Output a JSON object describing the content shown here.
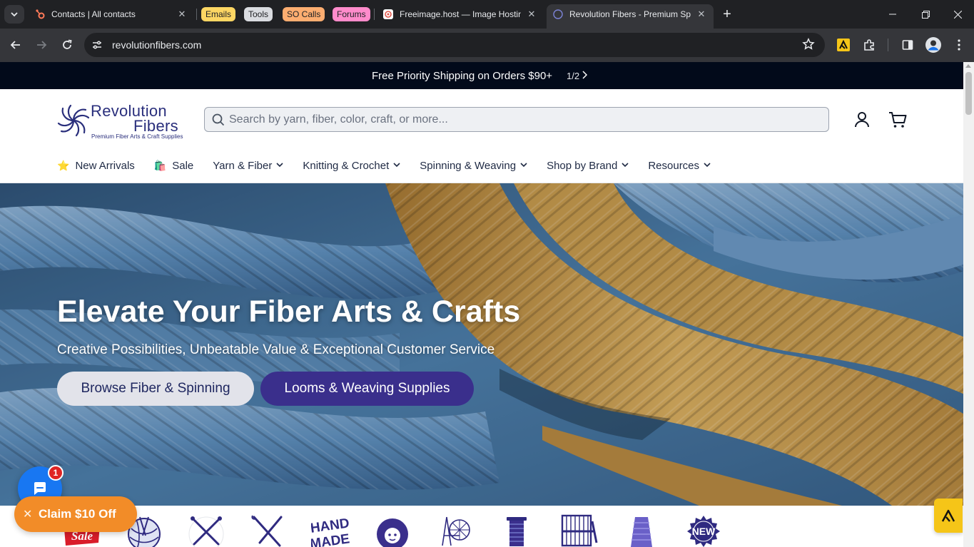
{
  "browser": {
    "tabs": [
      {
        "title": "Contacts | All contacts",
        "favicon": "hubspot-icon"
      },
      {
        "title": "Freeimage.host — Image Hostin",
        "favicon": "freeimage-icon"
      },
      {
        "title": "Revolution Fibers - Premium Sp",
        "favicon": "revolution-fibers-icon",
        "active": true
      }
    ],
    "tab_groups": [
      {
        "label": "Emails",
        "color": "#fdd663"
      },
      {
        "label": "Tools",
        "color": "#dadce0"
      },
      {
        "label": "SO Calls",
        "color": "#fcad70"
      },
      {
        "label": "Forums",
        "color": "#ff8bcb"
      }
    ],
    "url": "revolutionfibers.com"
  },
  "announcement": {
    "text": "Free Priority Shipping on Orders $90+",
    "counter": "1/2"
  },
  "header": {
    "logo_line1": "Revolution",
    "logo_line2": "Fibers",
    "logo_tagline": "Premium Fiber Arts & Craft Supplies",
    "search_placeholder": "Search by yarn, fiber, color, craft, or more..."
  },
  "nav": {
    "items": [
      {
        "label": "New Arrivals",
        "emoji": "⭐"
      },
      {
        "label": "Sale",
        "emoji": "🛍️"
      },
      {
        "label": "Yarn & Fiber"
      },
      {
        "label": "Knitting & Crochet"
      },
      {
        "label": "Spinning & Weaving"
      },
      {
        "label": "Shop by Brand"
      },
      {
        "label": "Resources"
      }
    ]
  },
  "hero": {
    "title": "Elevate Your Fiber Arts & Crafts",
    "subtitle": "Creative Possibilities, Unbeatable Value & Exceptional Customer Service",
    "button_primary": "Browse Fiber & Spinning",
    "button_secondary": "Looms & Weaving Supplies"
  },
  "categories": {
    "sale_text": "Sale",
    "handmade_line1": "HAND",
    "handmade_line2": "MADE",
    "new_text": "NEW"
  },
  "widgets": {
    "chat_badge": "1",
    "claim_label": "Claim $10 Off"
  },
  "colors": {
    "brand_navy": "#2a2f7c",
    "brand_purple": "#3a2f8c",
    "claim_orange": "#f28c28",
    "chat_blue": "#1877f2"
  }
}
